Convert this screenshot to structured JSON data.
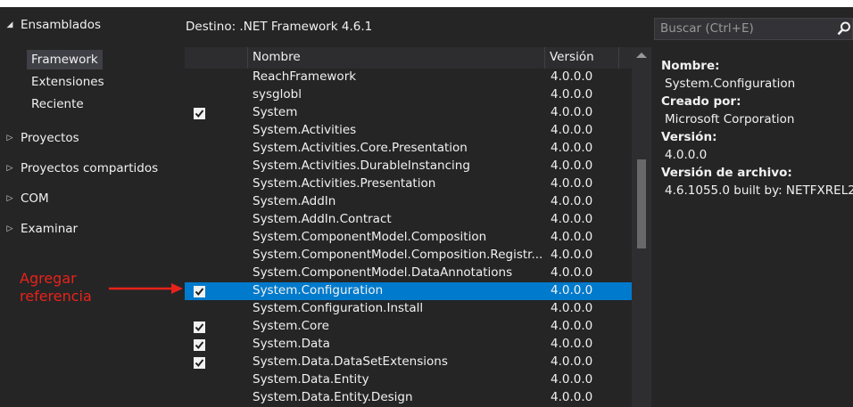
{
  "nav": {
    "assemblies": "Ensamblados",
    "sub_items": [
      "Framework",
      "Extensiones",
      "Reciente"
    ],
    "groups": [
      "Proyectos",
      "Proyectos compartidos",
      "COM",
      "Examinar"
    ]
  },
  "annotation": {
    "line1": "Agregar",
    "line2": "referencia"
  },
  "destination": "Destino: .NET Framework 4.6.1",
  "columns": {
    "name": "Nombre",
    "version": "Versión"
  },
  "rows": [
    {
      "name": "ReachFramework",
      "version": "4.0.0.0",
      "checked": false,
      "selected": false
    },
    {
      "name": "sysglobl",
      "version": "4.0.0.0",
      "checked": false,
      "selected": false
    },
    {
      "name": "System",
      "version": "4.0.0.0",
      "checked": true,
      "selected": false
    },
    {
      "name": "System.Activities",
      "version": "4.0.0.0",
      "checked": false,
      "selected": false
    },
    {
      "name": "System.Activities.Core.Presentation",
      "version": "4.0.0.0",
      "checked": false,
      "selected": false
    },
    {
      "name": "System.Activities.DurableInstancing",
      "version": "4.0.0.0",
      "checked": false,
      "selected": false
    },
    {
      "name": "System.Activities.Presentation",
      "version": "4.0.0.0",
      "checked": false,
      "selected": false
    },
    {
      "name": "System.AddIn",
      "version": "4.0.0.0",
      "checked": false,
      "selected": false
    },
    {
      "name": "System.AddIn.Contract",
      "version": "4.0.0.0",
      "checked": false,
      "selected": false
    },
    {
      "name": "System.ComponentModel.Composition",
      "version": "4.0.0.0",
      "checked": false,
      "selected": false
    },
    {
      "name": "System.ComponentModel.Composition.Registr...",
      "version": "4.0.0.0",
      "checked": false,
      "selected": false
    },
    {
      "name": "System.ComponentModel.DataAnnotations",
      "version": "4.0.0.0",
      "checked": false,
      "selected": false
    },
    {
      "name": "System.Configuration",
      "version": "4.0.0.0",
      "checked": true,
      "selected": true
    },
    {
      "name": "System.Configuration.Install",
      "version": "4.0.0.0",
      "checked": false,
      "selected": false
    },
    {
      "name": "System.Core",
      "version": "4.0.0.0",
      "checked": true,
      "selected": false
    },
    {
      "name": "System.Data",
      "version": "4.0.0.0",
      "checked": true,
      "selected": false
    },
    {
      "name": "System.Data.DataSetExtensions",
      "version": "4.0.0.0",
      "checked": true,
      "selected": false
    },
    {
      "name": "System.Data.Entity",
      "version": "4.0.0.0",
      "checked": false,
      "selected": false
    },
    {
      "name": "System.Data.Entity.Design",
      "version": "4.0.0.0",
      "checked": false,
      "selected": false
    }
  ],
  "search": {
    "placeholder": "Buscar (Ctrl+E)"
  },
  "details": {
    "name_label": "Nombre:",
    "name_value": "System.Configuration",
    "creator_label": "Creado por:",
    "creator_value": "Microsoft Corporation",
    "version_label": "Versión:",
    "version_value": "4.0.0.0",
    "file_version_label": "Versión de archivo:",
    "file_version_value": "4.6.1055.0 built by: NETFXREL2"
  },
  "colors": {
    "background": "#252526",
    "selection": "#007acc",
    "annotation": "#e8221a",
    "header": "#2d2d30"
  },
  "icons": [
    "collapse-triangle-icon",
    "expand-triangle-icon",
    "checkbox-checked-icon",
    "search-icon",
    "scroll-up-arrow-icon",
    "annotation-arrow-icon"
  ]
}
